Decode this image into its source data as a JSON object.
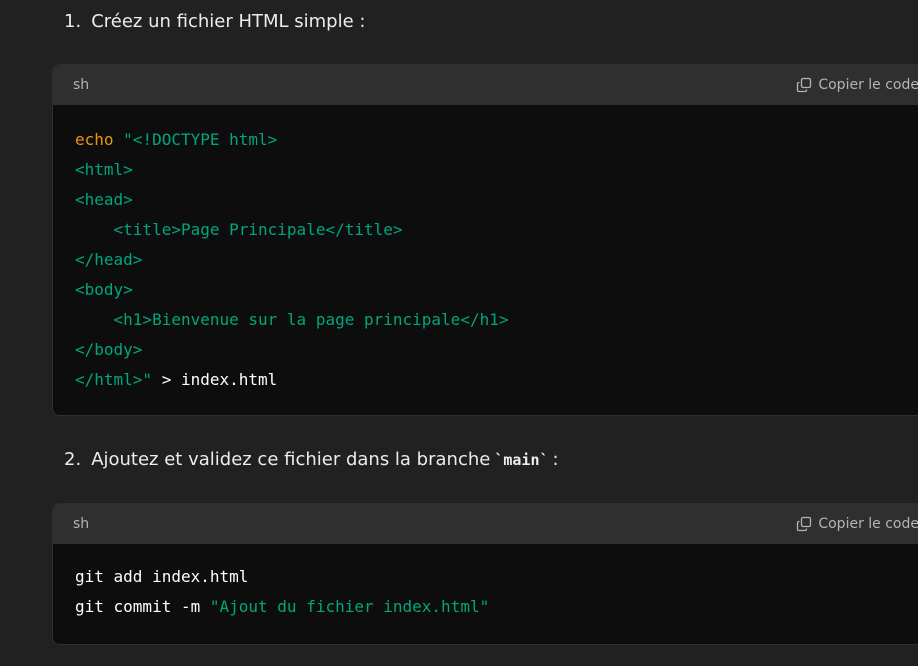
{
  "steps": [
    {
      "number": "1.",
      "text": "Créez un fichier HTML simple :"
    },
    {
      "number": "2.",
      "text_before": "Ajoutez et validez ce fichier dans la branche",
      "code": "`main`",
      "text_after": ":"
    }
  ],
  "code_blocks": [
    {
      "language": "sh",
      "copy_label": "Copier le code",
      "lines": [
        [
          {
            "t": "kw",
            "v": "echo"
          },
          {
            "t": "plain",
            "v": " "
          },
          {
            "t": "str",
            "v": "\"<!DOCTYPE html>"
          }
        ],
        [
          {
            "t": "str",
            "v": "<html>"
          }
        ],
        [
          {
            "t": "str",
            "v": "<head>"
          }
        ],
        [
          {
            "t": "str",
            "v": "    <title>Page Principale</title>"
          }
        ],
        [
          {
            "t": "str",
            "v": "</head>"
          }
        ],
        [
          {
            "t": "str",
            "v": "<body>"
          }
        ],
        [
          {
            "t": "str",
            "v": "    <h1>Bienvenue sur la page principale</h1>"
          }
        ],
        [
          {
            "t": "str",
            "v": "</body>"
          }
        ],
        [
          {
            "t": "str",
            "v": "</html>\""
          },
          {
            "t": "plain",
            "v": " > index.html"
          }
        ]
      ]
    },
    {
      "language": "sh",
      "copy_label": "Copier le code",
      "lines": [
        [
          {
            "t": "plain",
            "v": "git add index.html"
          }
        ],
        [
          {
            "t": "plain",
            "v": "git commit -m "
          },
          {
            "t": "str",
            "v": "\"Ajout du fichier index.html\""
          }
        ]
      ]
    }
  ],
  "colors": {
    "keyword": "#e9950c",
    "string": "#00a67d",
    "plain": "#ffffff",
    "background": "#212121",
    "code_background": "#0d0d0d",
    "code_header": "#2f2f2f"
  },
  "icons": {
    "copy": "copy-icon"
  }
}
